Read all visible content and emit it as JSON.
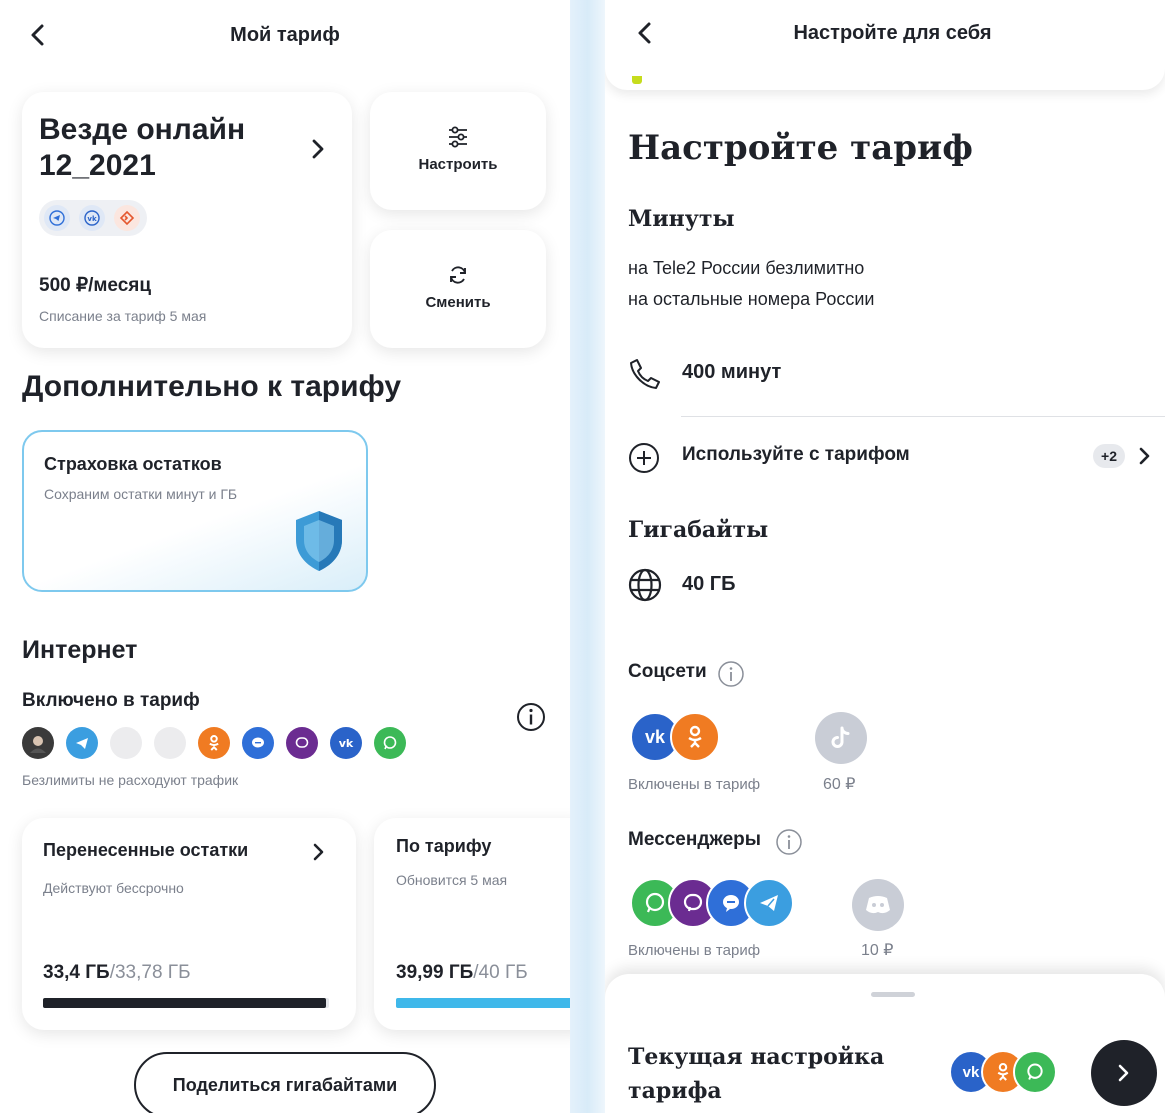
{
  "left": {
    "header": {
      "title": "Мой тариф"
    },
    "tariff_card": {
      "name_line1": "Везде онлайн",
      "name_line2": "12_2021",
      "price": "500 ₽/месяц",
      "charge_note": "Списание за тариф 5 мая"
    },
    "configure_button": {
      "label": "Настроить"
    },
    "change_button": {
      "label": "Сменить"
    },
    "extra_section": {
      "title": "Дополнительно к тарифу"
    },
    "insurance_card": {
      "title": "Страховка остатков",
      "subtitle": "Сохраним остатки минут и ГБ"
    },
    "internet": {
      "title": "Интернет",
      "included_label": "Включено в тариф",
      "unlimited_note": "Безлимиты не расходуют трафик",
      "apps": [
        {
          "icon": "avatar-icon",
          "color": "#3a3a3a"
        },
        {
          "icon": "telegram-icon",
          "color": "#3b9ee0"
        },
        {
          "icon": "blank-icon",
          "color": "#ececee"
        },
        {
          "icon": "blank-icon",
          "color": "#ececee"
        },
        {
          "icon": "odnoklassniki-icon",
          "color": "#f07b22"
        },
        {
          "icon": "messenger-icon",
          "color": "#2f6fd8"
        },
        {
          "icon": "viber-icon",
          "color": "#6b2c91"
        },
        {
          "icon": "vk-icon",
          "color": "#2a63c9"
        },
        {
          "icon": "whatsapp-icon",
          "color": "#3cb957"
        }
      ]
    },
    "carried_card": {
      "title": "Перенесенные остатки",
      "subtitle": "Действуют бессрочно",
      "used": "33,4 ГБ",
      "total": "/33,78 ГБ",
      "fill": 0.99
    },
    "tariff_gb_card": {
      "title": "По тарифу",
      "subtitle": "Обновится 5 мая",
      "used": "39,99 ГБ",
      "total": "/40 ГБ",
      "fill": 0.99
    },
    "share_button": {
      "label": "Поделиться гигабайтами"
    }
  },
  "right": {
    "header": {
      "title": "Настройте для себя"
    },
    "main_title": "Настройте тариф",
    "minutes": {
      "title": "Минуты",
      "line1": "на Tele2 России безлимитно",
      "line2": "на остальные номера России",
      "value": "400 минут"
    },
    "use_with": {
      "label": "Используйте с тарифом",
      "badge": "+2"
    },
    "gigabytes": {
      "title": "Гигабайты",
      "value": "40 ГБ"
    },
    "social": {
      "title": "Соцсети",
      "included": "Включены в тариф",
      "extra_price": "60 ₽"
    },
    "messengers": {
      "title": "Мессенджеры",
      "included": "Включены в тариф",
      "extra_price": "10 ₽"
    },
    "current": {
      "line1": "Текущая настройка",
      "line2": "тарифа"
    },
    "colors": {
      "vk": "#2a63c9",
      "ok": "#f07b22",
      "whatsapp": "#3cb957",
      "viber": "#6b2c91",
      "messenger": "#2f6fd8",
      "telegram": "#3b9ee0",
      "muted": "#c9cdd6"
    }
  }
}
